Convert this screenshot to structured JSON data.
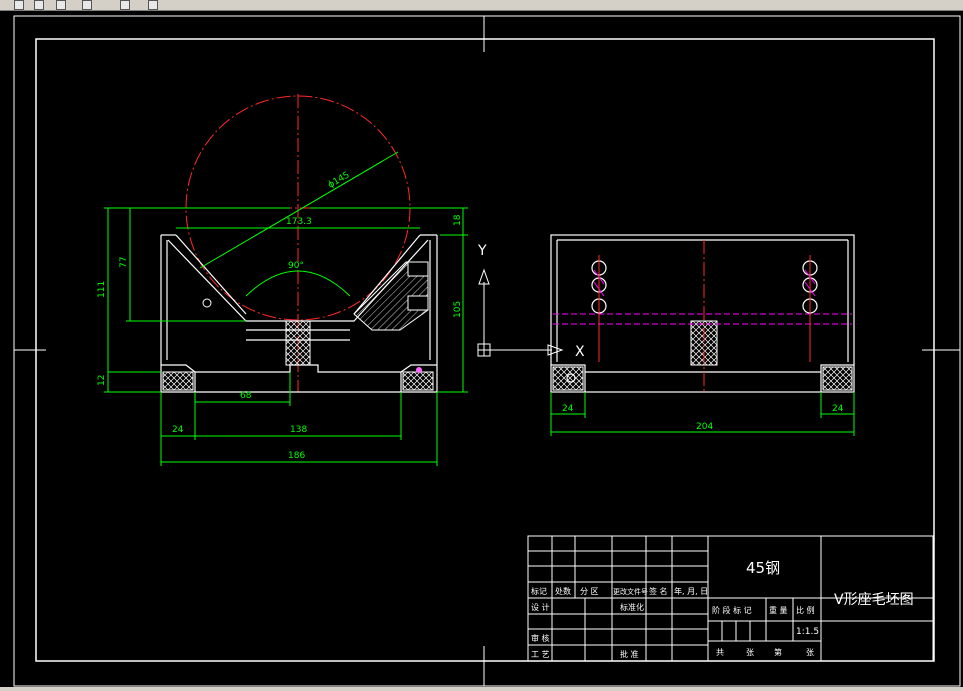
{
  "toolbar": {
    "icons": [
      "pencil-icon",
      "new-file-icon",
      "open-file-icon",
      "star-icon",
      "pointer-icon",
      "paint-icon"
    ]
  },
  "front_view": {
    "diameter_label": "ϕ145",
    "chord_label": "173.3",
    "angle_label": "90°",
    "dim_total_height": "111",
    "dim_v_depth": "77",
    "dim_top": "18",
    "dim_right_height": "105",
    "dim_base": "12",
    "dim_slot_width": "68",
    "dim_foot": "24",
    "dim_inner_width": "138",
    "dim_overall_width": "186"
  },
  "side_view": {
    "dim_foot_left": "24",
    "dim_foot_right": "24",
    "dim_length": "204"
  },
  "ucs": {
    "y_label": "Y",
    "x_label": "X"
  },
  "title_block": {
    "material": "45钢",
    "drawing_name": "V形座毛坯图",
    "scale": "1:1.5",
    "header_cells": [
      "标记",
      "处数",
      "分 区",
      "更改文件号",
      "签 名",
      "年, 月, 日"
    ],
    "design": "设 计",
    "standardize": "标准化",
    "review": "审 核",
    "process": "工 艺",
    "approve": "批 准",
    "stage_mark": "阶 段 标 记",
    "weight": "重 量",
    "ratio": "比 例",
    "total_sheets": "共",
    "sheets": "张",
    "sheet_no": "第",
    "sheet": "张"
  },
  "colors": {
    "background": "#000000",
    "outline": "#ffffff",
    "dimension": "#00ff00",
    "centerline": "#ff0000",
    "hidden": "#ff00ff"
  }
}
